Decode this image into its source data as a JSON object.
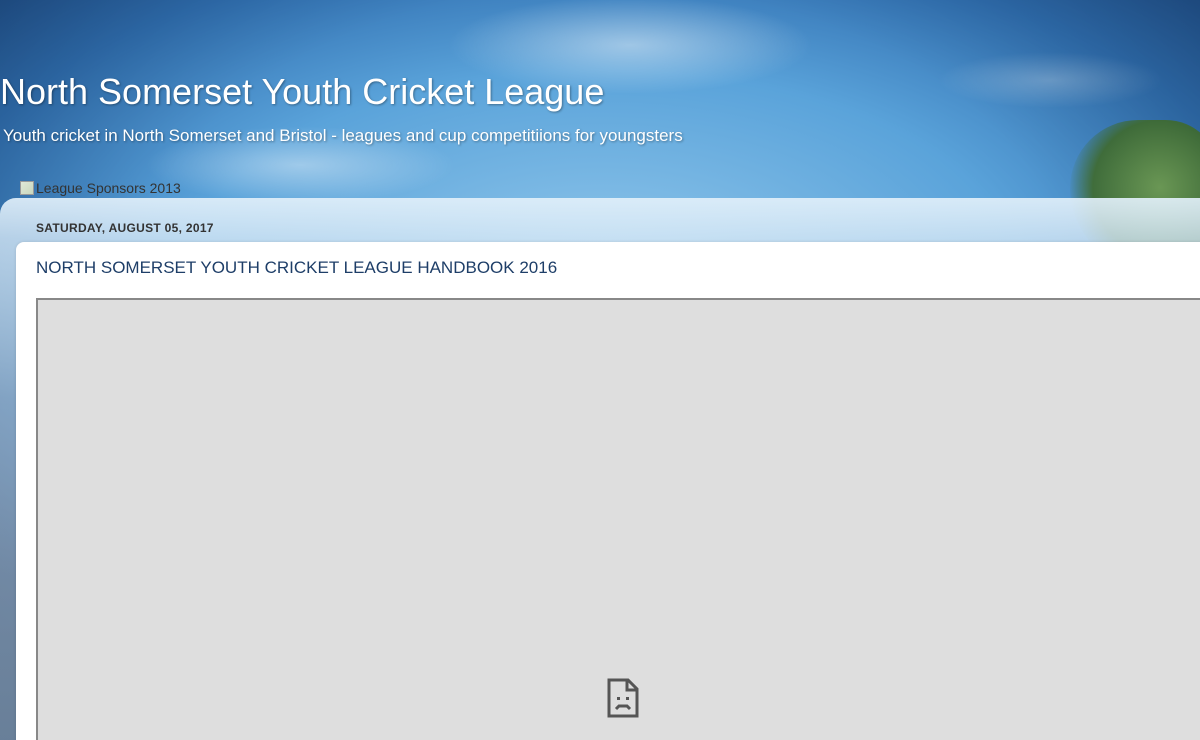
{
  "blog": {
    "title": "North Somerset Youth Cricket League",
    "description": "Youth cricket in North Somerset and Bristol - leagues and cup competitiions for youngsters"
  },
  "sponsor": {
    "alt_text": "League Sponsors 2013",
    "icon": "broken-image-icon"
  },
  "post": {
    "date": "SATURDAY, AUGUST 05, 2017",
    "title": "NORTH SOMERSET YOUTH CRICKET LEAGUE HANDBOOK 2016",
    "embed_status_icon": "sad-file-icon"
  },
  "colors": {
    "post_title": "#1e3e68",
    "embed_background": "#dedede",
    "header_text": "#ffffff"
  }
}
